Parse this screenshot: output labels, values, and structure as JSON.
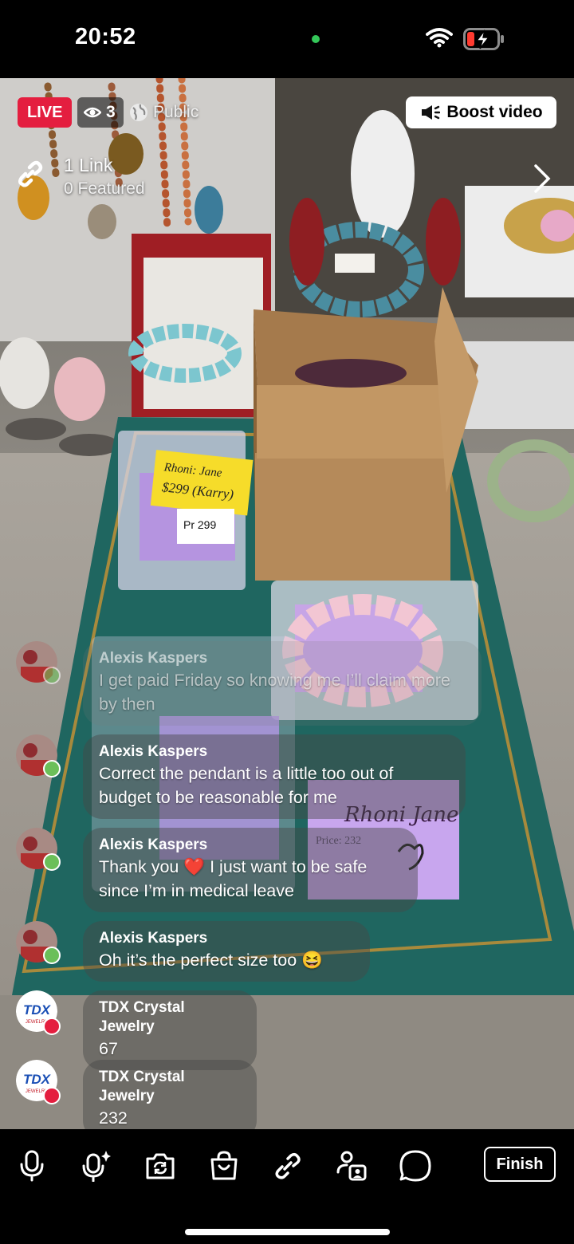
{
  "status": {
    "time": "20:52"
  },
  "overlay": {
    "live_label": "LIVE",
    "viewer_count": "3",
    "visibility": "Public",
    "boost_label": "Boost video",
    "link_title": "1 Link",
    "link_sub": "0 Featured"
  },
  "comments": [
    {
      "name": "Alexis Kaspers",
      "text": "I get paid Friday so knowing me I’ll claim more by then"
    },
    {
      "name": "Alexis Kaspers",
      "text": "Correct the pendant is a little too out of budget to be reasonable for me"
    },
    {
      "name": "Alexis Kaspers",
      "text": "Thank you ❤️ I just want to be safe since I’m in medical leave"
    },
    {
      "name": "Alexis Kaspers",
      "text": "Oh it’s the perfect size too 😆"
    },
    {
      "name": "TDX Crystal Jewelry",
      "text": "67"
    },
    {
      "name": "TDX Crystal Jewelry",
      "text": "232"
    }
  ],
  "scene": {
    "note1_line1": "Rhoni: Jane",
    "note1_line2": "$299 (Karry)",
    "tag_price": "Pr 299",
    "card_handwriting": "Rhoni Jane",
    "card_price": "Price: 232",
    "brand_avatar": "TDX",
    "brand_avatar_sub": "JEWELRY"
  },
  "toolbar": {
    "finish_label": "Finish"
  }
}
